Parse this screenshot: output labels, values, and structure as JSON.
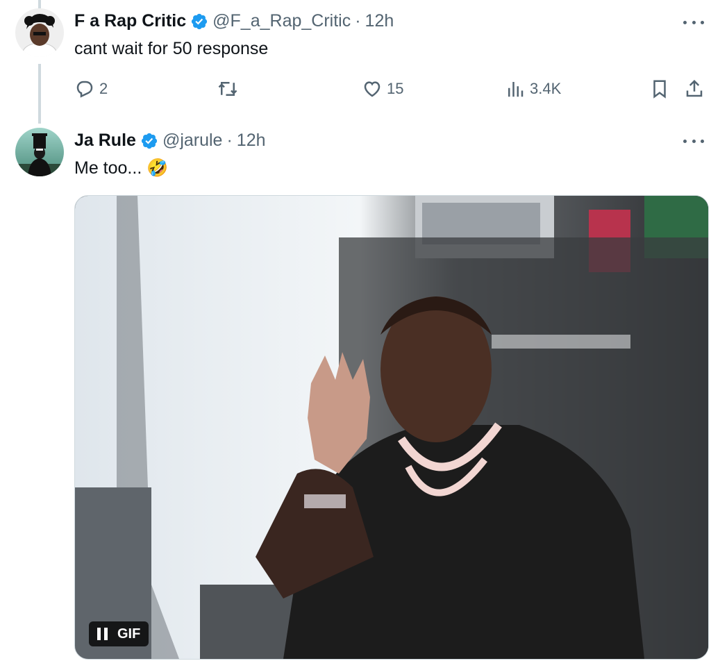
{
  "tweets": [
    {
      "name": "F a Rap Critic",
      "handle": "@F_a_Rap_Critic",
      "separator": "·",
      "time": "12h",
      "text": "cant wait for 50 response",
      "replies": "2",
      "likes": "15",
      "views": "3.4K"
    },
    {
      "name": "Ja Rule",
      "handle": "@jarule",
      "separator": "·",
      "time": "12h",
      "text": "Me too...",
      "emoji": "🤣",
      "media_badge": "GIF"
    }
  ],
  "colors": {
    "verified": "#1d9bf0",
    "secondary_text": "#536471",
    "thread_line": "#cfd9de"
  },
  "icons": [
    "verified-badge-icon",
    "more-icon",
    "reply-icon",
    "retweet-icon",
    "like-icon",
    "views-icon",
    "bookmark-icon",
    "share-icon",
    "pause-icon"
  ]
}
